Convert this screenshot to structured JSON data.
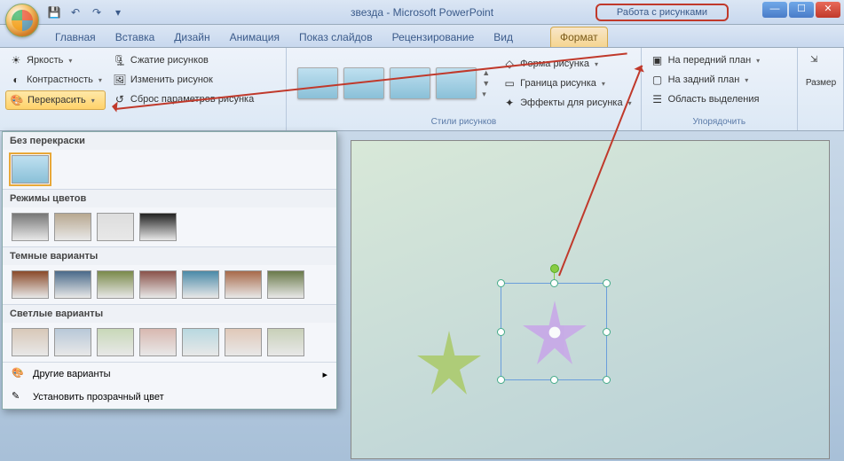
{
  "title": "звезда - Microsoft PowerPoint",
  "context_title": "Работа с рисунками",
  "tabs": {
    "home": "Главная",
    "insert": "Вставка",
    "design": "Дизайн",
    "anim": "Анимация",
    "slideshow": "Показ слайдов",
    "review": "Рецензирование",
    "view": "Вид",
    "format": "Формат"
  },
  "adjust": {
    "brightness": "Яркость",
    "contrast": "Контрастность",
    "recolor": "Перекрасить",
    "compress": "Сжатие рисунков",
    "change": "Изменить рисунок",
    "reset": "Сброс параметров рисунка"
  },
  "styles": {
    "shape": "Форма рисунка",
    "border": "Граница рисунка",
    "effects": "Эффекты для рисунка",
    "label": "Стили рисунков"
  },
  "arrange": {
    "front": "На передний план",
    "back": "На задний план",
    "selection": "Область выделения",
    "label": "Упорядочить"
  },
  "size": {
    "label": "Размер"
  },
  "recolor_panel": {
    "none": "Без перекраски",
    "modes": "Режимы цветов",
    "dark": "Темные варианты",
    "light": "Светлые варианты",
    "more": "Другие варианты",
    "transparent": "Установить прозрачный цвет"
  },
  "swatches": {
    "modes": [
      "#777",
      "#b8a890",
      "#ddd",
      "#222"
    ],
    "dark": [
      "#8a4a2a",
      "#4a6a8a",
      "#7a8a4a",
      "#8a524a",
      "#4a8aa8",
      "#a86a4a",
      "#6a7a4a"
    ],
    "light": [
      "#d8c8b8",
      "#b8c8d8",
      "#c8d8b8",
      "#d8b8b0",
      "#b8d8e0",
      "#e0c8b8",
      "#c8d0b8"
    ]
  }
}
